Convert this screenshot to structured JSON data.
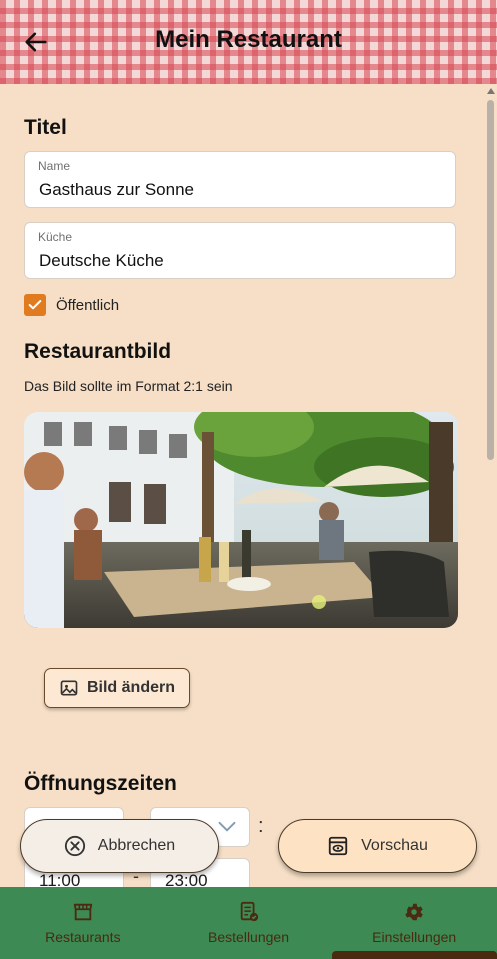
{
  "header": {
    "title": "Mein Restaurant"
  },
  "titel": {
    "heading": "Titel",
    "name_label": "Name",
    "name_value": "Gasthaus zur Sonne",
    "kueche_label": "Küche",
    "kueche_value": "Deutsche Küche",
    "public_label": "Öffentlich",
    "public_checked": true
  },
  "bild": {
    "heading": "Restaurantbild",
    "hint": "Das Bild sollte im Format 2:1 sein",
    "change_label": "Bild ändern"
  },
  "zeiten": {
    "heading": "Öffnungszeiten",
    "separator": ":",
    "dash": "-",
    "from": "11:00",
    "to": "23:00"
  },
  "actions": {
    "cancel": "Abbrechen",
    "preview": "Vorschau"
  },
  "nav": {
    "items": [
      {
        "label": "Restaurants",
        "icon": "store-icon"
      },
      {
        "label": "Bestellungen",
        "icon": "orders-icon"
      },
      {
        "label": "Einstellungen",
        "icon": "gear-icon"
      }
    ],
    "active": "Einstellungen"
  },
  "colors": {
    "accent": "#e07b20",
    "nav_bg": "#3d8a55",
    "page_bg": "#f6dfc6"
  }
}
